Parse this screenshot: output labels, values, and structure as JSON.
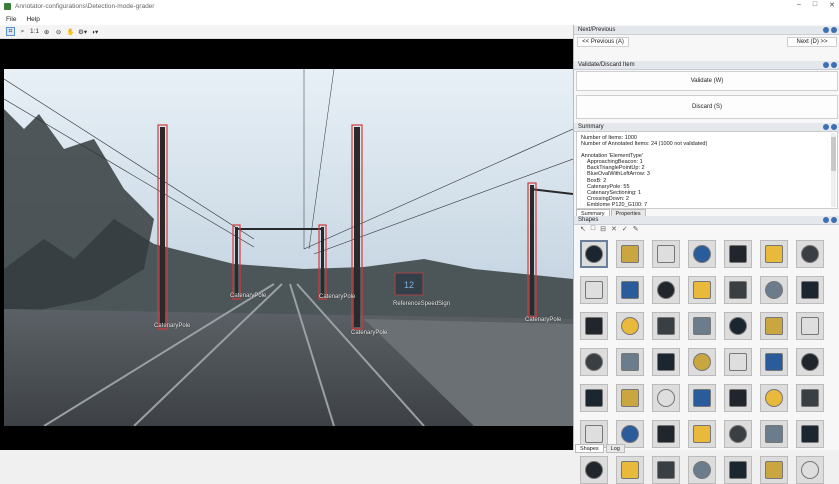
{
  "window": {
    "title": "Annotator-configurations\\Detection-mode-grader",
    "controls": [
      "–",
      "□",
      "✕"
    ]
  },
  "menu": {
    "items": [
      "File",
      "Help"
    ]
  },
  "toolbar": {
    "zoom_1to1": "1:1",
    "icons": [
      "select-rect-icon",
      "zoom-in-icon",
      "zoom-out-icon",
      "pan-hand-icon",
      "settings-icon",
      "contrast-icon"
    ]
  },
  "scene": {
    "annotations": [
      {
        "label": "CatenaryPole"
      },
      {
        "label": "CatenaryPole"
      },
      {
        "label": "CatenaryPole"
      },
      {
        "label": "CatenaryPole"
      },
      {
        "label": "ReferenceSpeedSign"
      },
      {
        "label": "CatenaryPole"
      }
    ],
    "sign_text": "12"
  },
  "next_previous": {
    "header": "Next/Previous",
    "previous_label": "<< Previous (A)",
    "next_label": "Next (D) >>"
  },
  "validate_discard": {
    "header": "Validate/Discard Item",
    "validate_label": "Validate (W)",
    "discard_label": "Discard (S)"
  },
  "summary": {
    "header": "Summary",
    "lines": [
      "Number of Items: 1000",
      "Number of Annotated Items: 24 (1000 not validated)",
      "",
      "Annotation 'ElementType'",
      "ApproachingBeacon: 1",
      "BackTrianglePointUp: 2",
      "BlueOvalWithLeftArrow: 3",
      "BoxB: 2",
      "CatenaryPole: 55",
      "CatenarySectioning: 1",
      "CrossingDown: 2",
      "Emblome P120_G100: 7"
    ],
    "tabs": [
      "Summary",
      "Properties"
    ]
  },
  "shapes": {
    "header": "Shapes",
    "tools": [
      "↖",
      "□",
      "⊟",
      "✕",
      "✓",
      "✎"
    ],
    "count": 49
  },
  "bottom_tabs": [
    "Shapes",
    "Log"
  ],
  "colors": {
    "annotation_box": "#d23a3a",
    "panel_header": "#e4e7ec",
    "accent": "#3d6fb5"
  }
}
